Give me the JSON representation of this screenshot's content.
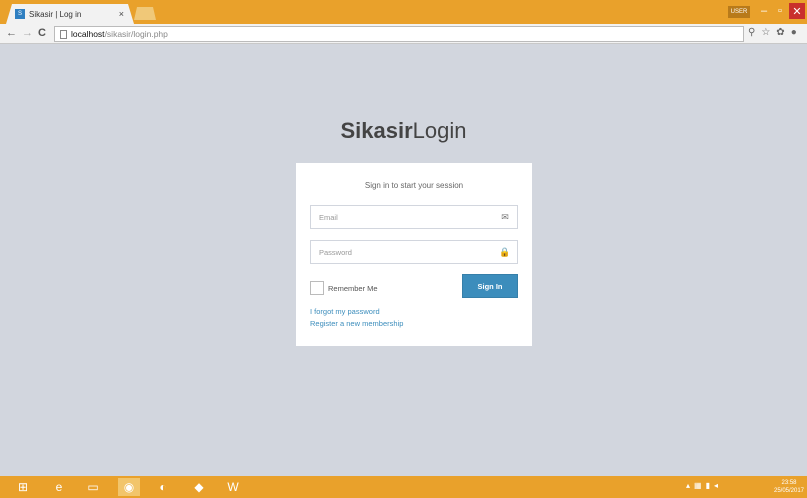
{
  "browser": {
    "tab_title": "Sikasir | Log in",
    "tab_favicon": "S",
    "tab_close": "×",
    "user_badge": "USER",
    "url_host": "localhost",
    "url_path": "/sikasir/login.php"
  },
  "page": {
    "logo_bold": "Sikasir",
    "logo_light": "Login",
    "box_msg": "Sign in to start your session",
    "email_placeholder": "Email",
    "password_placeholder": "Password",
    "remember_label": "Remember Me",
    "signin_label": "Sign In",
    "forgot_link": "I forgot my password",
    "register_link": "Register a new membership"
  },
  "taskbar": {
    "clock_time": "23:58",
    "clock_date": "25/05/2017"
  },
  "colors": {
    "accent": "#3c8dbc",
    "background": "#d2d6de",
    "titlebar": "#e9a12b"
  }
}
